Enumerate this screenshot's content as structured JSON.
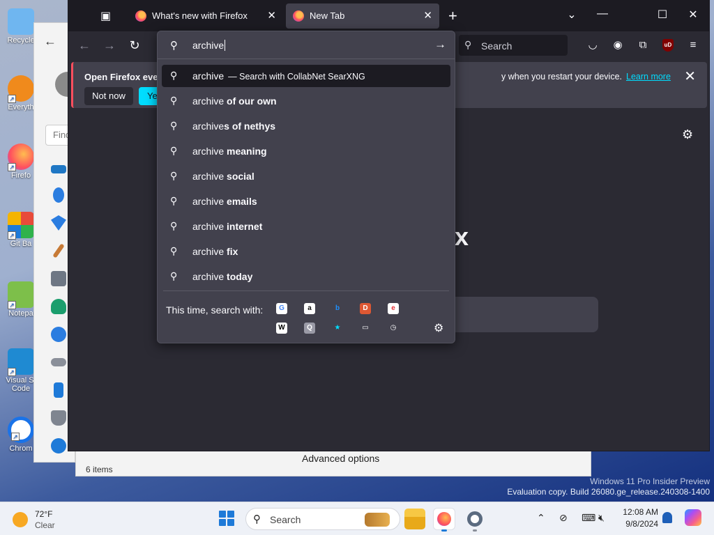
{
  "desktop": {
    "icons": [
      {
        "label": "Recycle",
        "color": "#6fb6f0"
      },
      {
        "label": "Everyth",
        "color": "#f08a1c"
      },
      {
        "label": "Firefo",
        "color": "#ff6a3a"
      },
      {
        "label": "Git Ba",
        "color": "#e84b3a"
      },
      {
        "label": "Notepa",
        "color": "#7dbf4a"
      },
      {
        "label": "Visual St",
        "label2": "Code",
        "color": "#1f8ad2"
      },
      {
        "label": "Chrom",
        "color": "#1a73e8"
      }
    ],
    "watermark": {
      "line1": "Windows 11 Pro Insider Preview",
      "line2": "Evaluation copy. Build 26080.ge_release.240308-1400"
    }
  },
  "settings_window": {
    "back_icon": "back-arrow-icon",
    "find_placeholder": "Find",
    "items_count": "6 items",
    "advanced_options": "Advanced options"
  },
  "firefox": {
    "tabs": [
      {
        "title": "What's new with Firefox",
        "active": false
      },
      {
        "title": "New Tab",
        "active": true
      }
    ],
    "search_placeholder": "Search",
    "notification": {
      "message": "Open Firefox every",
      "message_tail": "y when you restart your device.",
      "learn_more": "Learn more",
      "not_now": "Not now",
      "yes": "Yes"
    },
    "content_glyph": "x"
  },
  "urlbar": {
    "typed": "archive",
    "first_suggestion": {
      "text": "archive",
      "hint": "— Search with CollabNet SearXNG"
    },
    "suggestions": [
      {
        "prefix": "archive",
        "bold": " of our own"
      },
      {
        "prefix": "archive",
        "bold": "s of nethys"
      },
      {
        "prefix": "archive",
        "bold": " meaning"
      },
      {
        "prefix": "archive",
        "bold": " social"
      },
      {
        "prefix": "archive",
        "bold": " emails"
      },
      {
        "prefix": "archive",
        "bold": " internet"
      },
      {
        "prefix": "archive",
        "bold": " fix"
      },
      {
        "prefix": "archive",
        "bold": " today"
      }
    ],
    "oneoff_label": "This time, search with:",
    "engines_row1": [
      {
        "name": "google-icon",
        "glyph": "G",
        "bg": "#ffffff",
        "fg": "#4285f4"
      },
      {
        "name": "amazon-icon",
        "glyph": "a",
        "bg": "#ffffff",
        "fg": "#111111"
      },
      {
        "name": "bing-icon",
        "glyph": "b",
        "bg": "#42414d",
        "fg": "#1e90ff"
      },
      {
        "name": "duckduckgo-icon",
        "glyph": "D",
        "bg": "#de5833",
        "fg": "#ffffff"
      },
      {
        "name": "ebay-icon",
        "glyph": "e",
        "bg": "#ffffff",
        "fg": "#e53238"
      }
    ],
    "engines_row2": [
      {
        "name": "wikipedia-icon",
        "glyph": "W",
        "bg": "#ffffff",
        "fg": "#000000"
      },
      {
        "name": "searxng-icon",
        "glyph": "Q",
        "bg": "#9a9aa6",
        "fg": "#ffffff"
      },
      {
        "name": "bookmarks-icon",
        "glyph": "★",
        "bg": "#42414d",
        "fg": "#00ddff"
      },
      {
        "name": "tabs-icon",
        "glyph": "▭",
        "bg": "#42414d",
        "fg": "#fbfbfe"
      },
      {
        "name": "history-icon",
        "glyph": "◷",
        "bg": "#42414d",
        "fg": "#fbfbfe"
      }
    ]
  },
  "taskbar": {
    "weather_temp": "72°F",
    "weather_cond": "Clear",
    "search_placeholder": "Search",
    "time": "12:08 AM",
    "date": "9/8/2024"
  }
}
